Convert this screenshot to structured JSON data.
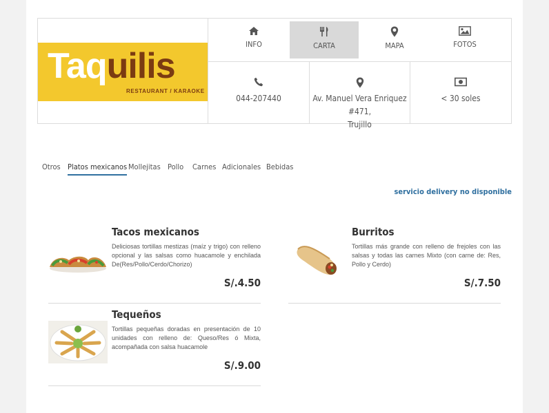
{
  "logo": {
    "word_white": "Taq",
    "word_dark": "uilis",
    "tagline": "RESTAURANT / KARAOKE"
  },
  "nav": [
    {
      "label": "INFO",
      "icon": "home-icon"
    },
    {
      "label": "CARTA",
      "icon": "utensils-icon"
    },
    {
      "label": "MAPA",
      "icon": "map-marker-icon"
    },
    {
      "label": "FOTOS",
      "icon": "picture-icon"
    }
  ],
  "info": {
    "phone": "044-207440",
    "address_line1": "Av. Manuel Vera Enriquez #471,",
    "address_line2": "Trujillo",
    "price": "< 30 soles"
  },
  "tabs": [
    "Otros",
    "Platos mexicanos",
    "Mollejitas",
    "Pollo",
    "Carnes",
    "Adicionales",
    "Bebidas"
  ],
  "delivery": "servicio delivery no disponible",
  "items": [
    {
      "name": "Tacos mexicanos",
      "desc": "Deliciosas tortillas mestizas (maíz y trigo) con relleno opcional y las salsas como huacamole y enchilada De(Res/Pollo/Cerdo/Chorizo)",
      "price": "S/.4.50",
      "image": "tacos-image"
    },
    {
      "name": "Burritos",
      "desc": "Tortillas más grande con relleno de frejoles con las salsas y todas las carnes Mixto (con carne de: Res, Pollo y Cerdo)",
      "price": "S/.7.50",
      "image": "burrito-image"
    },
    {
      "name": "Tequeños",
      "desc": "Tortillas pequeñas doradas en presentación de 10 unidades con relleno de: Queso/Res ó Mixta, acompañada con salsa huacamole",
      "price": "S/.9.00",
      "image": "tequenos-image"
    }
  ],
  "colors": {
    "logo_yellow": "#f3c82d",
    "logo_brown": "#7b3b12",
    "accent_blue": "#2f6f9f",
    "active_nav": "#d9d9d9"
  }
}
